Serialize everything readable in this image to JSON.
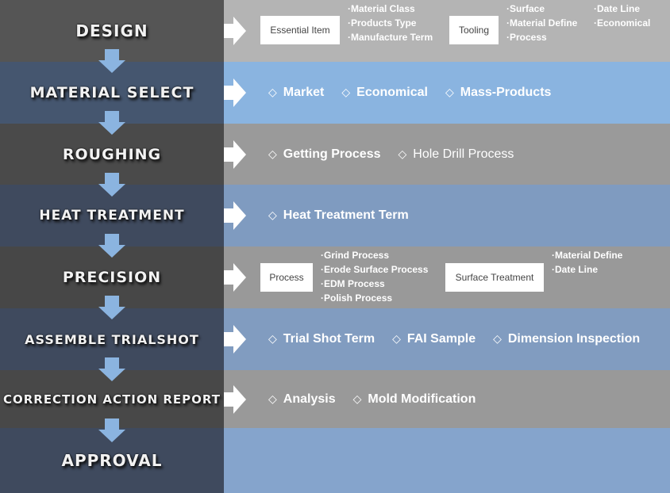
{
  "colors": {
    "arrow": "#8bb4e0"
  },
  "steps": [
    {
      "title": "DESIGN"
    },
    {
      "title": "MATERIAL SELECT",
      "items": [
        "Market",
        "Economical",
        "Mass-Products"
      ]
    },
    {
      "title": "ROUGHING",
      "items": [
        "Getting Process",
        "Hole Drill Process"
      ]
    },
    {
      "title": "HEAT TREATMENT",
      "items": [
        "Heat Treatment Term"
      ]
    },
    {
      "title": "PRECISION"
    },
    {
      "title": "ASSEMBLE TRIALSHOT",
      "items": [
        "Trial Shot Term",
        "FAI Sample",
        "Dimension Inspection"
      ]
    },
    {
      "title": "CORRECTION ACTION REPORT",
      "items": [
        "Analysis",
        "Mold Modification"
      ]
    },
    {
      "title": "APPROVAL"
    }
  ],
  "design": {
    "box1": "Essential Item",
    "list1": [
      "·Material Class",
      "·Products Type",
      "·Manufacture Term"
    ],
    "box2": "Tooling",
    "list2": [
      "·Surface",
      "·Material Define",
      "·Process"
    ],
    "list3": [
      "·Date Line",
      "·Economical"
    ]
  },
  "precision": {
    "box1": "Process",
    "list1": [
      "·Grind Process",
      "·Erode Surface Process",
      "·EDM Process",
      "·Polish Process"
    ],
    "box2": "Surface Treatment",
    "list2": [
      "·Material Define",
      "·Date Line"
    ]
  },
  "marker": "◇"
}
